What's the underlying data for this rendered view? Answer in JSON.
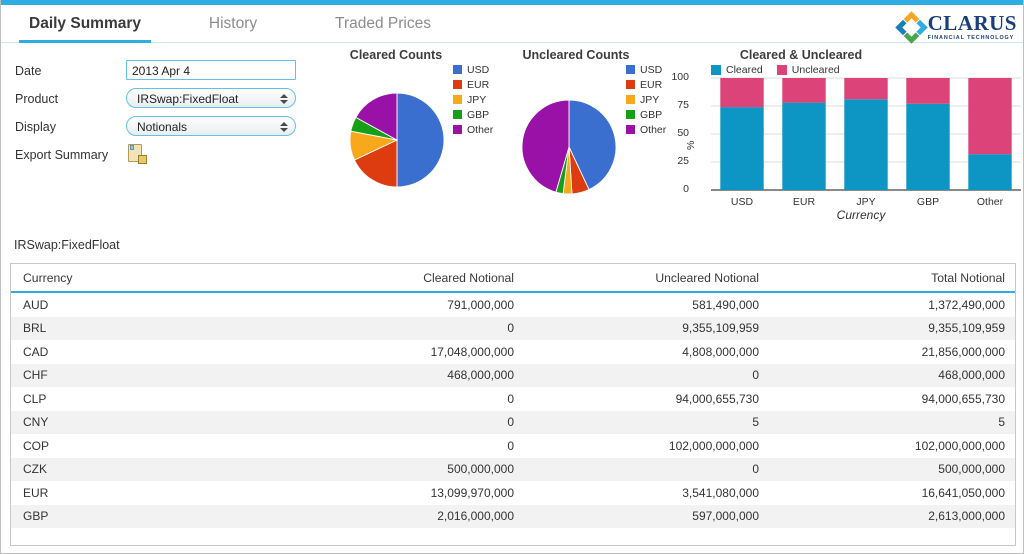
{
  "brand": {
    "name": "CLARUS",
    "tagline": "FINANCIAL TECHNOLOGY",
    "accent": "#2fade2",
    "navy": "#1b3f7a"
  },
  "tabs": [
    {
      "label": "Daily Summary",
      "active": true
    },
    {
      "label": "History",
      "active": false
    },
    {
      "label": "Traded Prices",
      "active": false
    }
  ],
  "form": {
    "date": {
      "label": "Date",
      "value": "2013 Apr 4"
    },
    "product": {
      "label": "Product",
      "value": "IRSwap:FixedFloat"
    },
    "display": {
      "label": "Display",
      "value": "Notionals"
    },
    "export": {
      "label": "Export Summary",
      "icon": "export-document-icon"
    }
  },
  "product_caption": "IRSwap:FixedFloat",
  "chart_data": [
    {
      "type": "pie",
      "title": "Cleared Counts",
      "categories": [
        "USD",
        "EUR",
        "JPY",
        "GBP",
        "Other"
      ],
      "values": [
        50,
        18,
        10,
        5,
        17
      ],
      "colors": [
        "#3a6fd0",
        "#dd3c11",
        "#f7a81b",
        "#17a017",
        "#9a11a8"
      ],
      "legend_position": "right"
    },
    {
      "type": "pie",
      "title": "Uncleared Counts",
      "categories": [
        "USD",
        "EUR",
        "JPY",
        "GBP",
        "Other"
      ],
      "values": [
        43,
        6,
        3,
        2.5,
        45.5
      ],
      "colors": [
        "#3a6fd0",
        "#dd3c11",
        "#f7a81b",
        "#17a017",
        "#9a11a8"
      ],
      "legend_position": "right"
    },
    {
      "type": "bar",
      "stacked": true,
      "title": "Cleared & Uncleared",
      "categories": [
        "USD",
        "EUR",
        "JPY",
        "GBP",
        "Other"
      ],
      "series": [
        {
          "name": "Cleared",
          "values": [
            74,
            78,
            81,
            77,
            32
          ],
          "color": "#0d95c4"
        },
        {
          "name": "Uncleared",
          "values": [
            26,
            22,
            19,
            23,
            68
          ],
          "color": "#db4379"
        }
      ],
      "xlabel": "Currency",
      "ylabel": "%",
      "ylim": [
        0,
        100
      ],
      "yticks": [
        0,
        25,
        50,
        75,
        100
      ],
      "grid": true,
      "legend_position": "top"
    }
  ],
  "table": {
    "columns": [
      "Currency",
      "Cleared Notional",
      "Uncleared Notional",
      "Total Notional"
    ],
    "rows": [
      {
        "currency": "AUD",
        "cleared": "791,000,000",
        "uncleared": "581,490,000",
        "total": "1,372,490,000"
      },
      {
        "currency": "BRL",
        "cleared": "0",
        "uncleared": "9,355,109,959",
        "total": "9,355,109,959"
      },
      {
        "currency": "CAD",
        "cleared": "17,048,000,000",
        "uncleared": "4,808,000,000",
        "total": "21,856,000,000"
      },
      {
        "currency": "CHF",
        "cleared": "468,000,000",
        "uncleared": "0",
        "total": "468,000,000"
      },
      {
        "currency": "CLP",
        "cleared": "0",
        "uncleared": "94,000,655,730",
        "total": "94,000,655,730"
      },
      {
        "currency": "CNY",
        "cleared": "0",
        "uncleared": "5",
        "total": "5"
      },
      {
        "currency": "COP",
        "cleared": "0",
        "uncleared": "102,000,000,000",
        "total": "102,000,000,000"
      },
      {
        "currency": "CZK",
        "cleared": "500,000,000",
        "uncleared": "0",
        "total": "500,000,000"
      },
      {
        "currency": "EUR",
        "cleared": "13,099,970,000",
        "uncleared": "3,541,080,000",
        "total": "16,641,050,000"
      },
      {
        "currency": "GBP",
        "cleared": "2,016,000,000",
        "uncleared": "597,000,000",
        "total": "2,613,000,000"
      }
    ]
  }
}
